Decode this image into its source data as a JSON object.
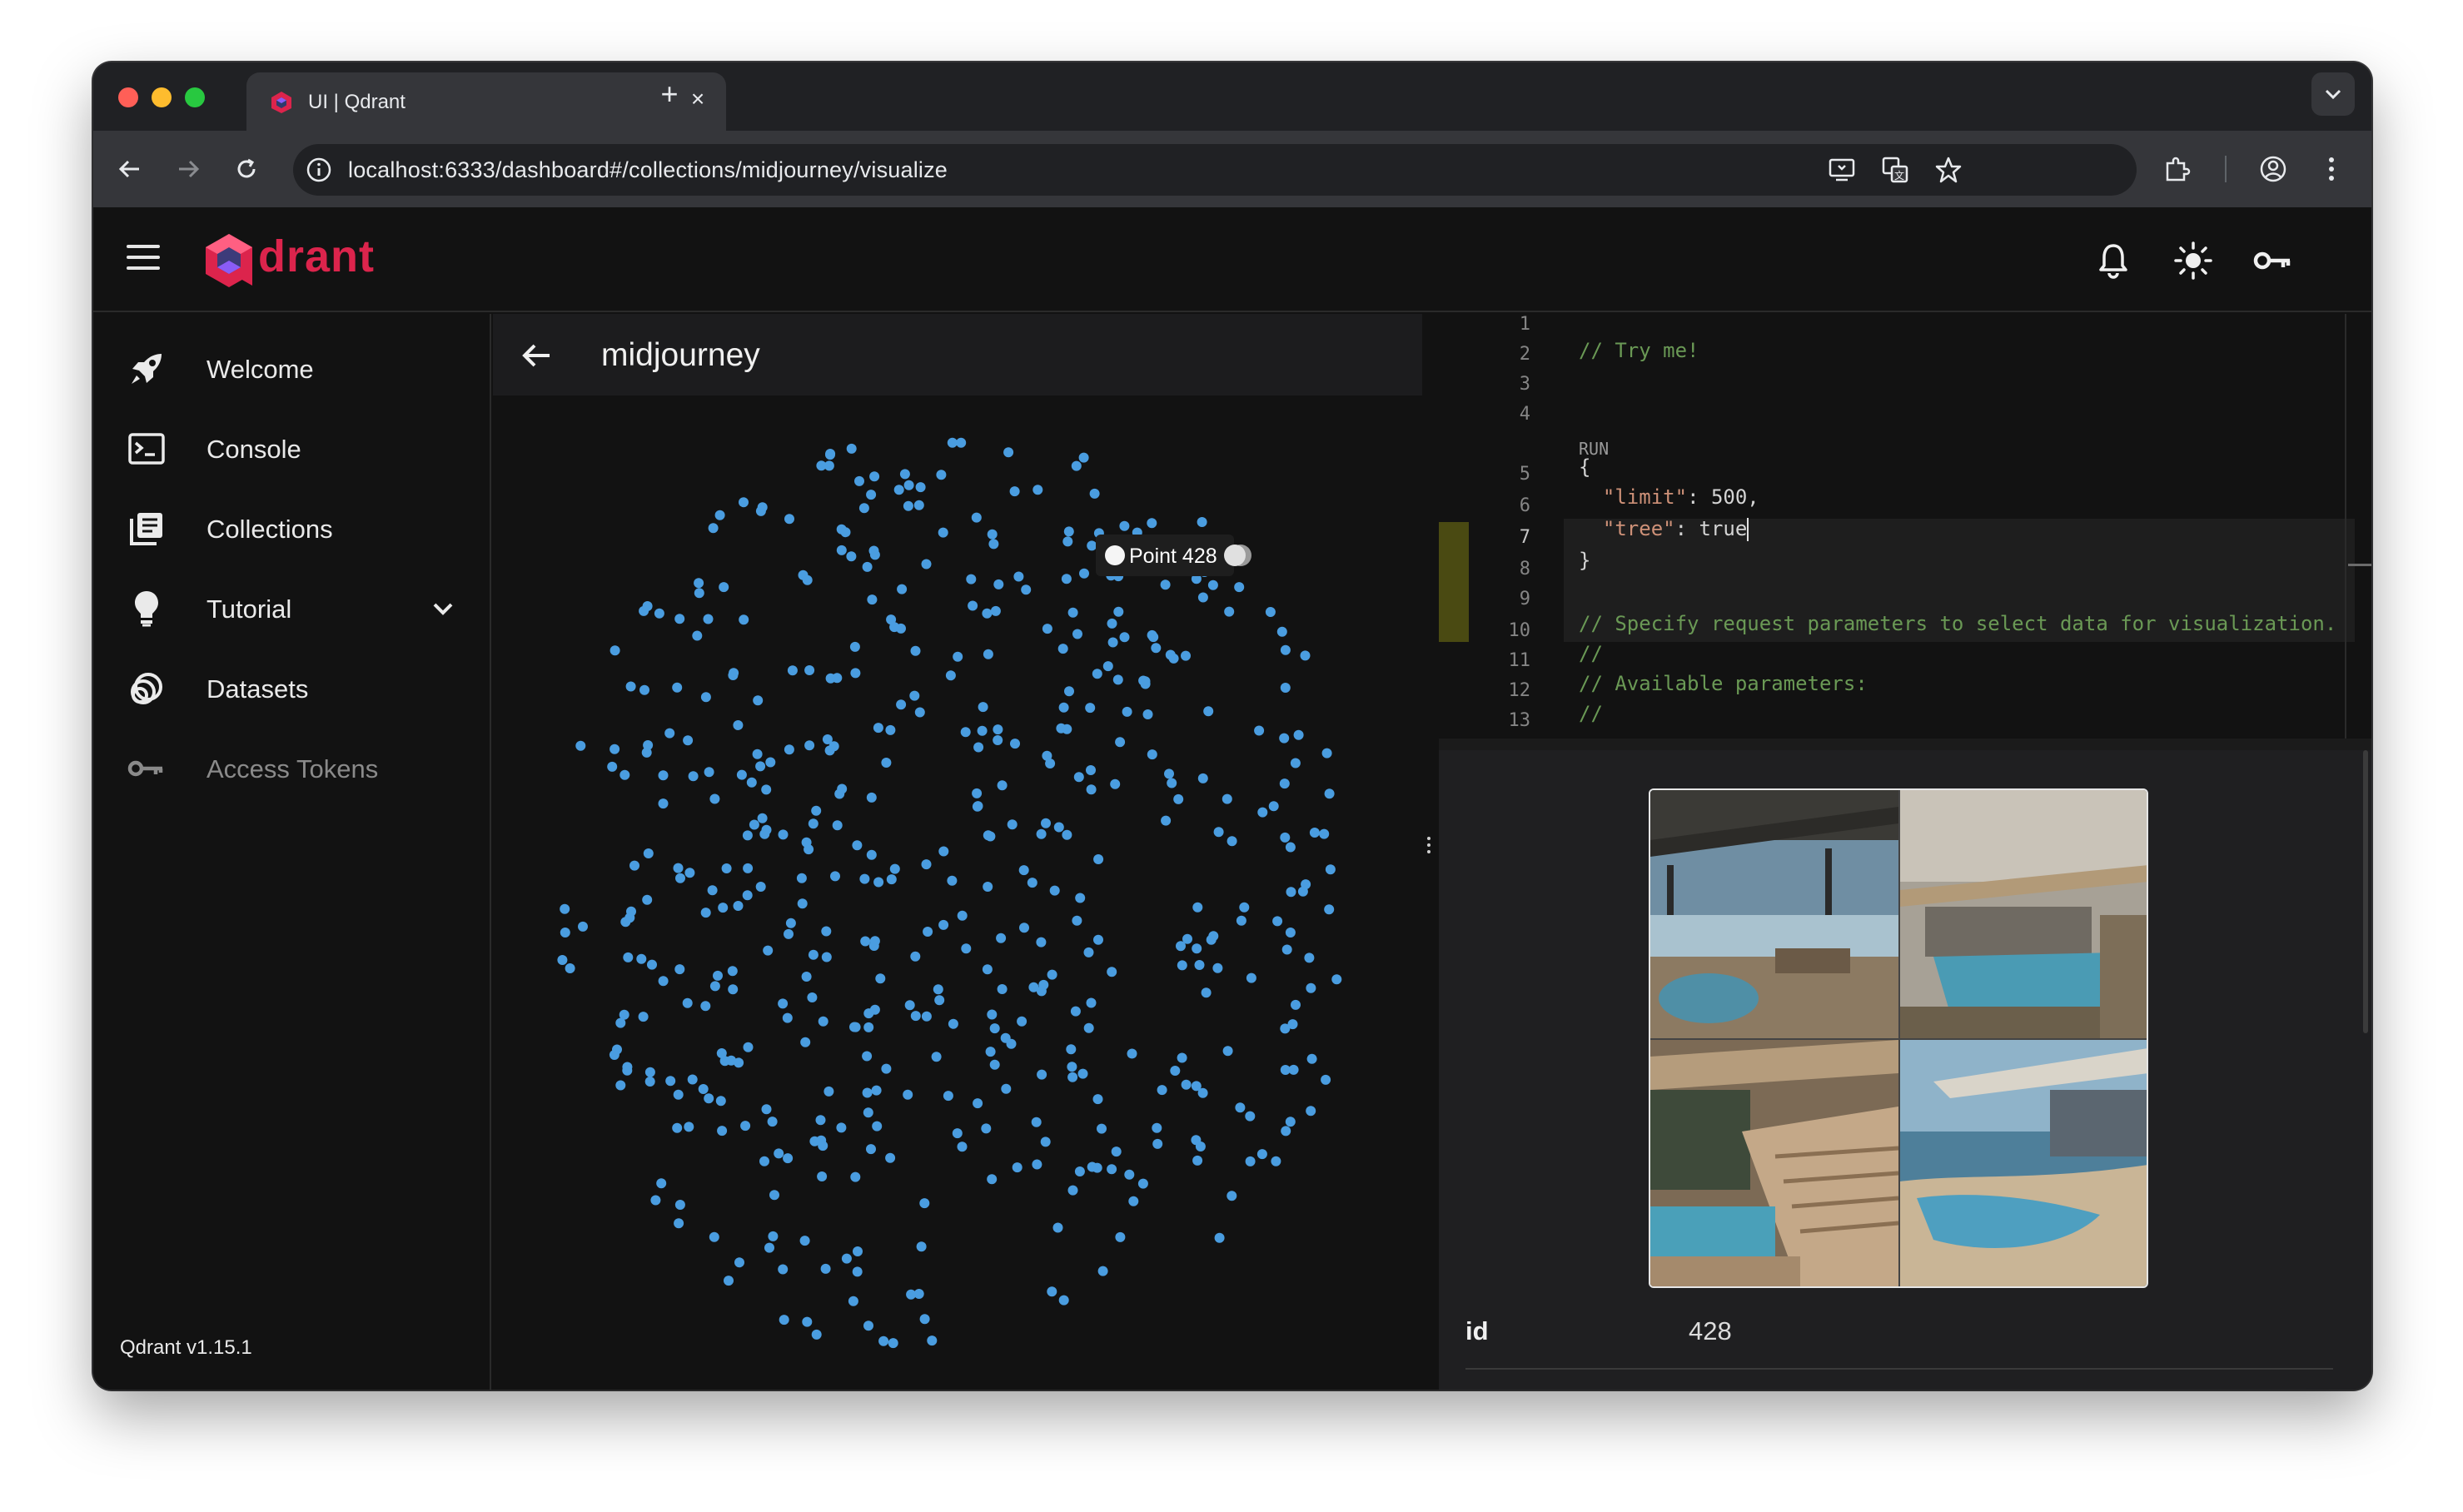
{
  "browser": {
    "tab_title": "UI | Qdrant",
    "tab_close": "×",
    "new_tab": "+",
    "url": "localhost:6333/dashboard#/collections/midjourney/visualize"
  },
  "header": {
    "logo_text": "drant",
    "icons": [
      "bell-icon",
      "sun-icon",
      "key-icon"
    ]
  },
  "sidebar": {
    "items": [
      {
        "label": "Welcome",
        "icon": "rocket-icon"
      },
      {
        "label": "Console",
        "icon": "terminal-icon"
      },
      {
        "label": "Collections",
        "icon": "collections-icon"
      },
      {
        "label": "Tutorial",
        "icon": "lightbulb-icon"
      },
      {
        "label": "Datasets",
        "icon": "datasets-icon"
      },
      {
        "label": "Access Tokens",
        "icon": "key-icon"
      }
    ],
    "version": "Qdrant v1.15.1"
  },
  "main": {
    "collection_name": "midjourney",
    "tooltip": "Point 428"
  },
  "editor": {
    "line_numbers": [
      "1",
      "2",
      "3",
      "4",
      "5",
      "6",
      "7",
      "8",
      "9",
      "10",
      "11",
      "12",
      "13"
    ],
    "active_line": "7",
    "lines": {
      "l3": "// Try me!",
      "run": "RUN",
      "l5": "{",
      "l6_key": "\"limit\"",
      "l6_val": ": 500,",
      "l7_key": "\"tree\"",
      "l7_val": ": true",
      "l8": "}",
      "l10": "// Specify request parameters to select data for visualization.",
      "l11": "//",
      "l12": "// Available parameters:",
      "l13": "//"
    },
    "sash_dots": "..."
  },
  "detail": {
    "key": "id",
    "value": "428"
  },
  "colors": {
    "accent": "#dc244c",
    "point": "#4a9de0",
    "background": "#121212"
  }
}
